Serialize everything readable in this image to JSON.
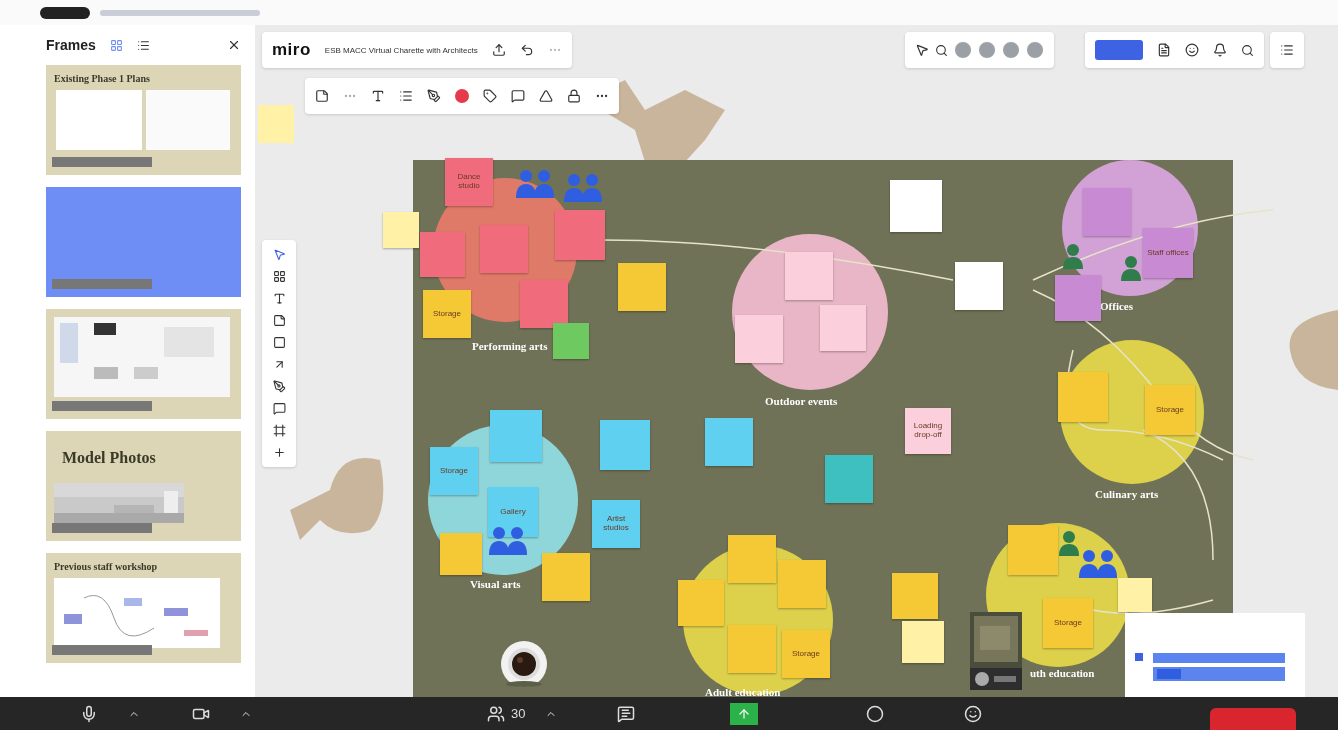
{
  "sidebar": {
    "title": "Frames",
    "frames": [
      {
        "kind": "plans",
        "title": "Existing Phase 1 Plans"
      },
      {
        "kind": "blank"
      },
      {
        "kind": "screenshot"
      },
      {
        "title": "Model Photos"
      },
      {
        "kind": "diagram",
        "title": "Previous staff workshop"
      }
    ]
  },
  "topbar": {
    "logo": "miro",
    "board_title": "ESB MACC Virtual Charette with Architects"
  },
  "board": {
    "zones": [
      {
        "label": "Performing arts",
        "color": "#e07a68"
      },
      {
        "label": "Outdoor events",
        "color": "#e8b6c6"
      },
      {
        "label": "Offices",
        "color": "#d2a2d6"
      },
      {
        "label": "Culinary arts",
        "color": "#ddd04a"
      },
      {
        "label": "Visual arts",
        "color": "#8fd6da"
      },
      {
        "label": "Adult education",
        "color": "#ddd04a"
      },
      {
        "label": "uth education",
        "color": "#ddd04a"
      }
    ],
    "stickies": [
      {
        "text": "Dance studio",
        "color": "#f06b7c"
      },
      {
        "color": "#fff2a6"
      },
      {
        "color": "#f06b7c"
      },
      {
        "color": "#f06b7c"
      },
      {
        "color": "#f06b7c"
      },
      {
        "color": "#f06b7c"
      },
      {
        "text": "Storage",
        "color": "#f5c935"
      },
      {
        "color": "#f5c935"
      },
      {
        "color": "#6dc960"
      },
      {
        "color": "#ffffff"
      },
      {
        "color": "#ffffff"
      },
      {
        "color": "#fbd0dc"
      },
      {
        "color": "#fbd0dc"
      },
      {
        "color": "#fbd0dc"
      },
      {
        "text": "Loading drop-off",
        "color": "#fbd0dc"
      },
      {
        "color": "#c88ad2"
      },
      {
        "text": "Staff offices",
        "color": "#c88ad2"
      },
      {
        "color": "#c88ad2"
      },
      {
        "color": "#f5c935"
      },
      {
        "text": "Storage",
        "color": "#f5c935"
      },
      {
        "color": "#5fd0f0"
      },
      {
        "text": "Storage",
        "color": "#5fd0f0"
      },
      {
        "text": "Gallery",
        "color": "#5fd0f0"
      },
      {
        "color": "#5fd0f0"
      },
      {
        "color": "#5fd0f0"
      },
      {
        "text": "Artist studios",
        "color": "#5fd0f0"
      },
      {
        "color": "#3ec0c0"
      },
      {
        "color": "#f5c935"
      },
      {
        "color": "#f5c935"
      },
      {
        "color": "#f5c935"
      },
      {
        "color": "#f5c935"
      },
      {
        "color": "#f5c935"
      },
      {
        "color": "#f5c935"
      },
      {
        "text": "Storage",
        "color": "#f5c935"
      },
      {
        "color": "#f5c935"
      },
      {
        "color": "#fff2a6"
      },
      {
        "color": "#f5c935"
      },
      {
        "text": "Storage",
        "color": "#f5c935"
      },
      {
        "color": "#fff2a6"
      }
    ]
  },
  "meeting_bar": {
    "participants": "30"
  }
}
